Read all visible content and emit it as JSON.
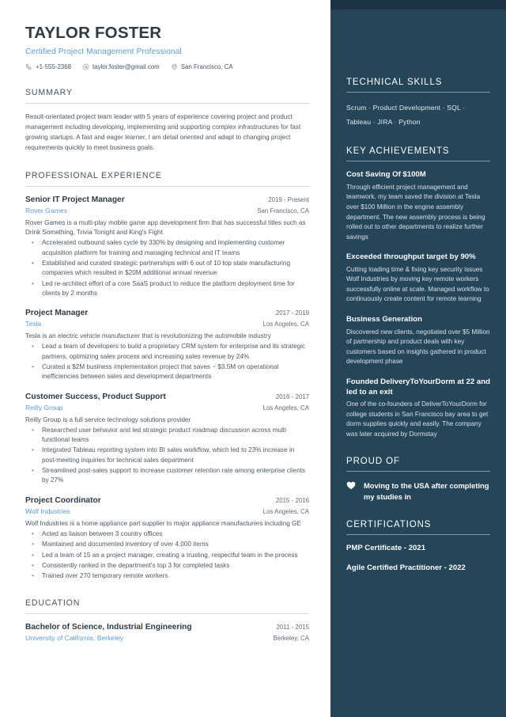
{
  "colors": {
    "sidebar_bg": "#254559",
    "sidebar_top_strip": "#1b3345",
    "accent_link": "#5b9bd5",
    "heading_dark": "#2f3a42",
    "body_text": "#4e5862"
  },
  "header": {
    "name": "TAYLOR FOSTER",
    "headline": "Certified Project Management Professional",
    "contacts": [
      {
        "icon": "phone-icon",
        "text": "+1-555-2368"
      },
      {
        "icon": "email-icon",
        "text": "taylor.foster@gmail.com"
      },
      {
        "icon": "location-pin-icon",
        "text": "San Francisco, CA"
      }
    ]
  },
  "summary": {
    "heading": "SUMMARY",
    "text": "Result-orientated project team leader with 5 years of experience covering project and product management including developing, implementing and supporting complex infrastructures for fast growing startups. A fast and eager learner, I am detail oriented and adapt to changing project requirements quickly to meet business goals."
  },
  "experience": {
    "heading": "PROFESSIONAL EXPERIENCE",
    "jobs": [
      {
        "title": "Senior IT Project Manager",
        "dates": "2019 - Present",
        "company": "Rover Games",
        "location": "San Francisco, CA",
        "description": "Rover Games is a multi-play mobile game app development firm that has successful titles such as Drink Something, Trivia Tonight and King's Fight",
        "bullets": [
          "Accelerated outbound sales cycle by 330% by designing and implementing customer acquisition platform for training and managing technical and IT teams",
          "Established and curated strategic partnerships with 6 out of 10 top state manufacturing companies which resulted in $20M additional annual revenue",
          "Led re-architect effort of a core SaaS product to reduce the platform deployment time for clients by 2 months"
        ]
      },
      {
        "title": "Project Manager",
        "dates": "2017 - 2019",
        "company": "Tesla",
        "location": "Los Angeles, CA",
        "description": "Tesla is an electric vehicle manufacturer that is revolutionizing the automobile industry",
        "bullets": [
          "Lead a team of developers to build a proprietary CRM system for enterprise and its strategic partners, optimizing sales process and increasing sales revenue by 24%",
          "Curated a $2M business implementation project that saves ~ $3.5M on operational inefficiencies between sales and development departments"
        ]
      },
      {
        "title": "Customer Success, Product Support",
        "dates": "2016 - 2017",
        "company": "Reilly Group",
        "location": "Los Angeles, CA",
        "description": "Reilly Group is a full service technology solutions provider",
        "bullets": [
          "Researched user behavior and led strategic product roadmap discussion across multi functional teams",
          "Integrated Tableau reporting system into BI sales workflow, which led to 23% increase in post-meeting inquiries for technical sales department",
          "Streamlined post-sales support to increase customer retention rate among enterprise clients by 27%"
        ]
      },
      {
        "title": "Project Coordinator",
        "dates": "2015 - 2016",
        "company": "Wolf Industries",
        "location": "Los Angeles, CA",
        "description": "Wolf Industries is a home appliance part supplier to major appliance manufacturers including GE",
        "bullets": [
          "Acted as liaison between 3 country offices",
          "Maintained and documented inventory of over 4,000 items",
          "Led a team of 15 as a project manager, creating a trusting, respectful team in the process",
          "Consistently ranked in the department's top 3 for completed tasks",
          "Trained over 270 temporary remote workers"
        ]
      }
    ]
  },
  "education": {
    "heading": "EDUCATION",
    "entries": [
      {
        "degree": "Bachelor of Science, Industrial Engineering",
        "dates": "2011 - 2015",
        "school": "University of California, Berkeley",
        "location": "Berkeley, CA"
      }
    ]
  },
  "sidebar": {
    "skills": {
      "heading": "TECHNICAL SKILLS",
      "line1": "Scrum · Product Development · SQL ·",
      "line2": "Tableau · JIRA · Python"
    },
    "achievements": {
      "heading": "KEY ACHIEVEMENTS",
      "items": [
        {
          "title": "Cost Saving Of $100M",
          "body": "Through efficient project management and teamwork, my team saved the division at Tesla over $100 Million in the engine assembly department. The new assembly process is being rolled out to other departments to realize further savings"
        },
        {
          "title": "Exceeded throughput target by 90%",
          "body": "Cutting loading time & fixing key security issues Wolf Industries by moving key remote workers successfully online at scale. Managed workflow to continuously create content for remote learning"
        },
        {
          "title": "Business Generation",
          "body": "Discovered new clients, negotiated over $5 Million of partnership and product deals with key customers based on insights gathered in product development phase"
        },
        {
          "title": "Founded DeliveryToYourDorm at 22 and led to an exit",
          "body": "One of the co-founders of DeliverToYourDorm for college students in San Francisco bay area to get dorm supplies quickly and easily. The company was later acquired by Dormstay"
        }
      ]
    },
    "proud_of": {
      "heading": "PROUD OF",
      "items": [
        {
          "icon": "heart-icon",
          "text": "Moving to the USA after completing my studies in"
        }
      ]
    },
    "certifications": {
      "heading": "CERTIFICATIONS",
      "items": [
        "PMP Certificate - 2021",
        "Agile Certified Practitioner - 2022"
      ]
    }
  }
}
